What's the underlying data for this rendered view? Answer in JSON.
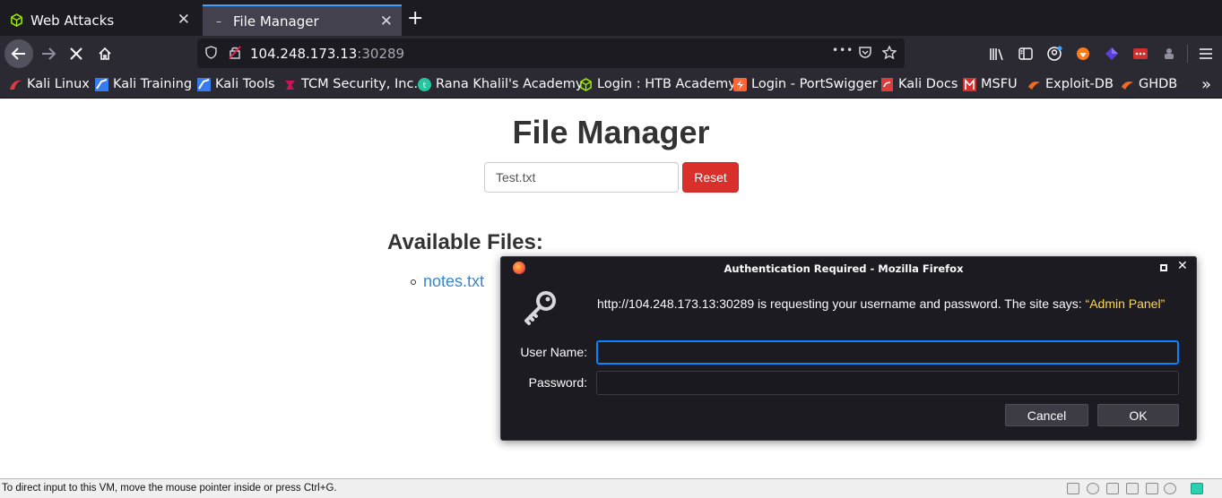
{
  "browser": {
    "tabs": [
      {
        "label": "Web Attacks",
        "icon": "hack-the-box-icon",
        "active": false
      },
      {
        "label": "File Manager",
        "icon": "page-dash-icon",
        "active": true
      }
    ],
    "new_tab": "+",
    "url_host": "104.248.173.13",
    "url_port": ":30289",
    "url_more": "•••",
    "bookmarks": [
      {
        "label": "Kali Linux",
        "color": "#e33b3b"
      },
      {
        "label": "Kali Training",
        "color": "#367bf0"
      },
      {
        "label": "Kali Tools",
        "color": "#367bf0"
      },
      {
        "label": "TCM Security, Inc.",
        "color": "#c2185b"
      },
      {
        "label": "Rana Khalil's Academy",
        "color": "#26c6a0"
      },
      {
        "label": "Login : HTB Academy",
        "color": "#9fef00"
      },
      {
        "label": "Login - PortSwigger",
        "color": "#ff6633"
      },
      {
        "label": "Kali Docs",
        "color": "#e33b3b"
      },
      {
        "label": "MSFU",
        "color": "#d32f2f"
      },
      {
        "label": "Exploit-DB",
        "color": "#f26b21"
      },
      {
        "label": "GHDB",
        "color": "#f26b21"
      }
    ],
    "bookmarks_more": "»"
  },
  "page": {
    "title": "File Manager",
    "file_input_value": "Test.txt",
    "reset_label": "Reset",
    "files_heading": "Available Files:",
    "files": [
      "notes.txt"
    ]
  },
  "dialog": {
    "title": "Authentication Required - Mozilla Firefox",
    "message": "http://104.248.173.13:30289 is requesting your username and password. The site says: ",
    "realm": "“Admin Panel”",
    "username_label": "User Name:",
    "password_label": "Password:",
    "cancel_label": "Cancel",
    "ok_label": "OK"
  },
  "vm_status": {
    "text": "To direct input to this VM, move the mouse pointer inside or press Ctrl+G."
  },
  "colors": {
    "accent": "#0a84ff",
    "reset": "#d9302c",
    "link": "#3a87c7",
    "realm": "#ffd84a"
  }
}
